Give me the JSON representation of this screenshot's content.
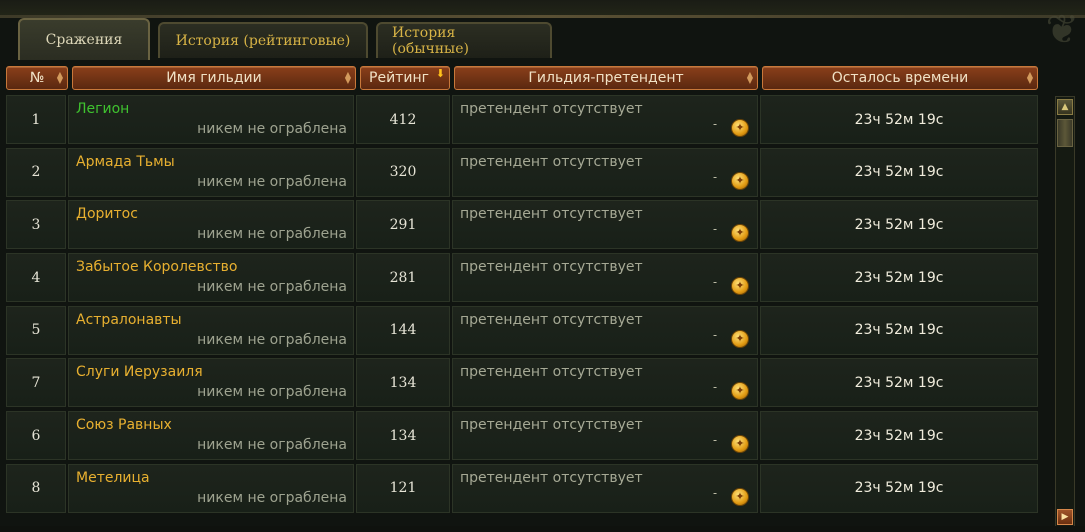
{
  "tabs": [
    {
      "label": "Сражения",
      "active": true
    },
    {
      "label": "История (рейтинговые)",
      "active": false
    },
    {
      "label": "История (обычные)",
      "active": false
    }
  ],
  "columns": {
    "num": "№",
    "name": "Имя гильдии",
    "rating": "Рейтинг",
    "challenger": "Гильдия-претендент",
    "time": "Осталось времени"
  },
  "rows": [
    {
      "num": "1",
      "guild": "Легион",
      "status": "никем не ограблена",
      "rating": "412",
      "challenger": "претендент отсутствует",
      "challenger_value": "-",
      "time": "23ч 52м 19с",
      "highlight": true
    },
    {
      "num": "2",
      "guild": "Армада Тьмы",
      "status": "никем не ограблена",
      "rating": "320",
      "challenger": "претендент отсутствует",
      "challenger_value": "-",
      "time": "23ч 52м 19с",
      "highlight": false
    },
    {
      "num": "3",
      "guild": "Доритос",
      "status": "никем не ограблена",
      "rating": "291",
      "challenger": "претендент отсутствует",
      "challenger_value": "-",
      "time": "23ч 52м 19с",
      "highlight": false
    },
    {
      "num": "4",
      "guild": "Забытое Королевство",
      "status": "никем не ограблена",
      "rating": "281",
      "challenger": "претендент отсутствует",
      "challenger_value": "-",
      "time": "23ч 52м 19с",
      "highlight": false
    },
    {
      "num": "5",
      "guild": "Астралонавты",
      "status": "никем не ограблена",
      "rating": "144",
      "challenger": "претендент отсутствует",
      "challenger_value": "-",
      "time": "23ч 52м 19с",
      "highlight": false
    },
    {
      "num": "7",
      "guild": "Слуги Иерузаиля",
      "status": "никем не ограблена",
      "rating": "134",
      "challenger": "претендент отсутствует",
      "challenger_value": "-",
      "time": "23ч 52м 19с",
      "highlight": false
    },
    {
      "num": "6",
      "guild": "Союз Равных",
      "status": "никем не ограблена",
      "rating": "134",
      "challenger": "претендент отсутствует",
      "challenger_value": "-",
      "time": "23ч 52м 19с",
      "highlight": false
    },
    {
      "num": "8",
      "guild": "Метелица",
      "status": "никем не ограблена",
      "rating": "121",
      "challenger": "претендент отсутствует",
      "challenger_value": "-",
      "time": "23ч 52м 19с",
      "highlight": false
    }
  ],
  "colors": {
    "guild_name": "#e8b030",
    "guild_name_highlight": "#3fc22f",
    "header_bg": "#8a3f1a",
    "sort_active": "#ffc21a"
  },
  "icons": {
    "coin": "gold-coin-icon",
    "sort": "sort-arrows-icon",
    "sort_active": "sort-desc-icon",
    "scroll_up": "scroll-up-icon",
    "scroll_down": "scroll-down-icon"
  }
}
